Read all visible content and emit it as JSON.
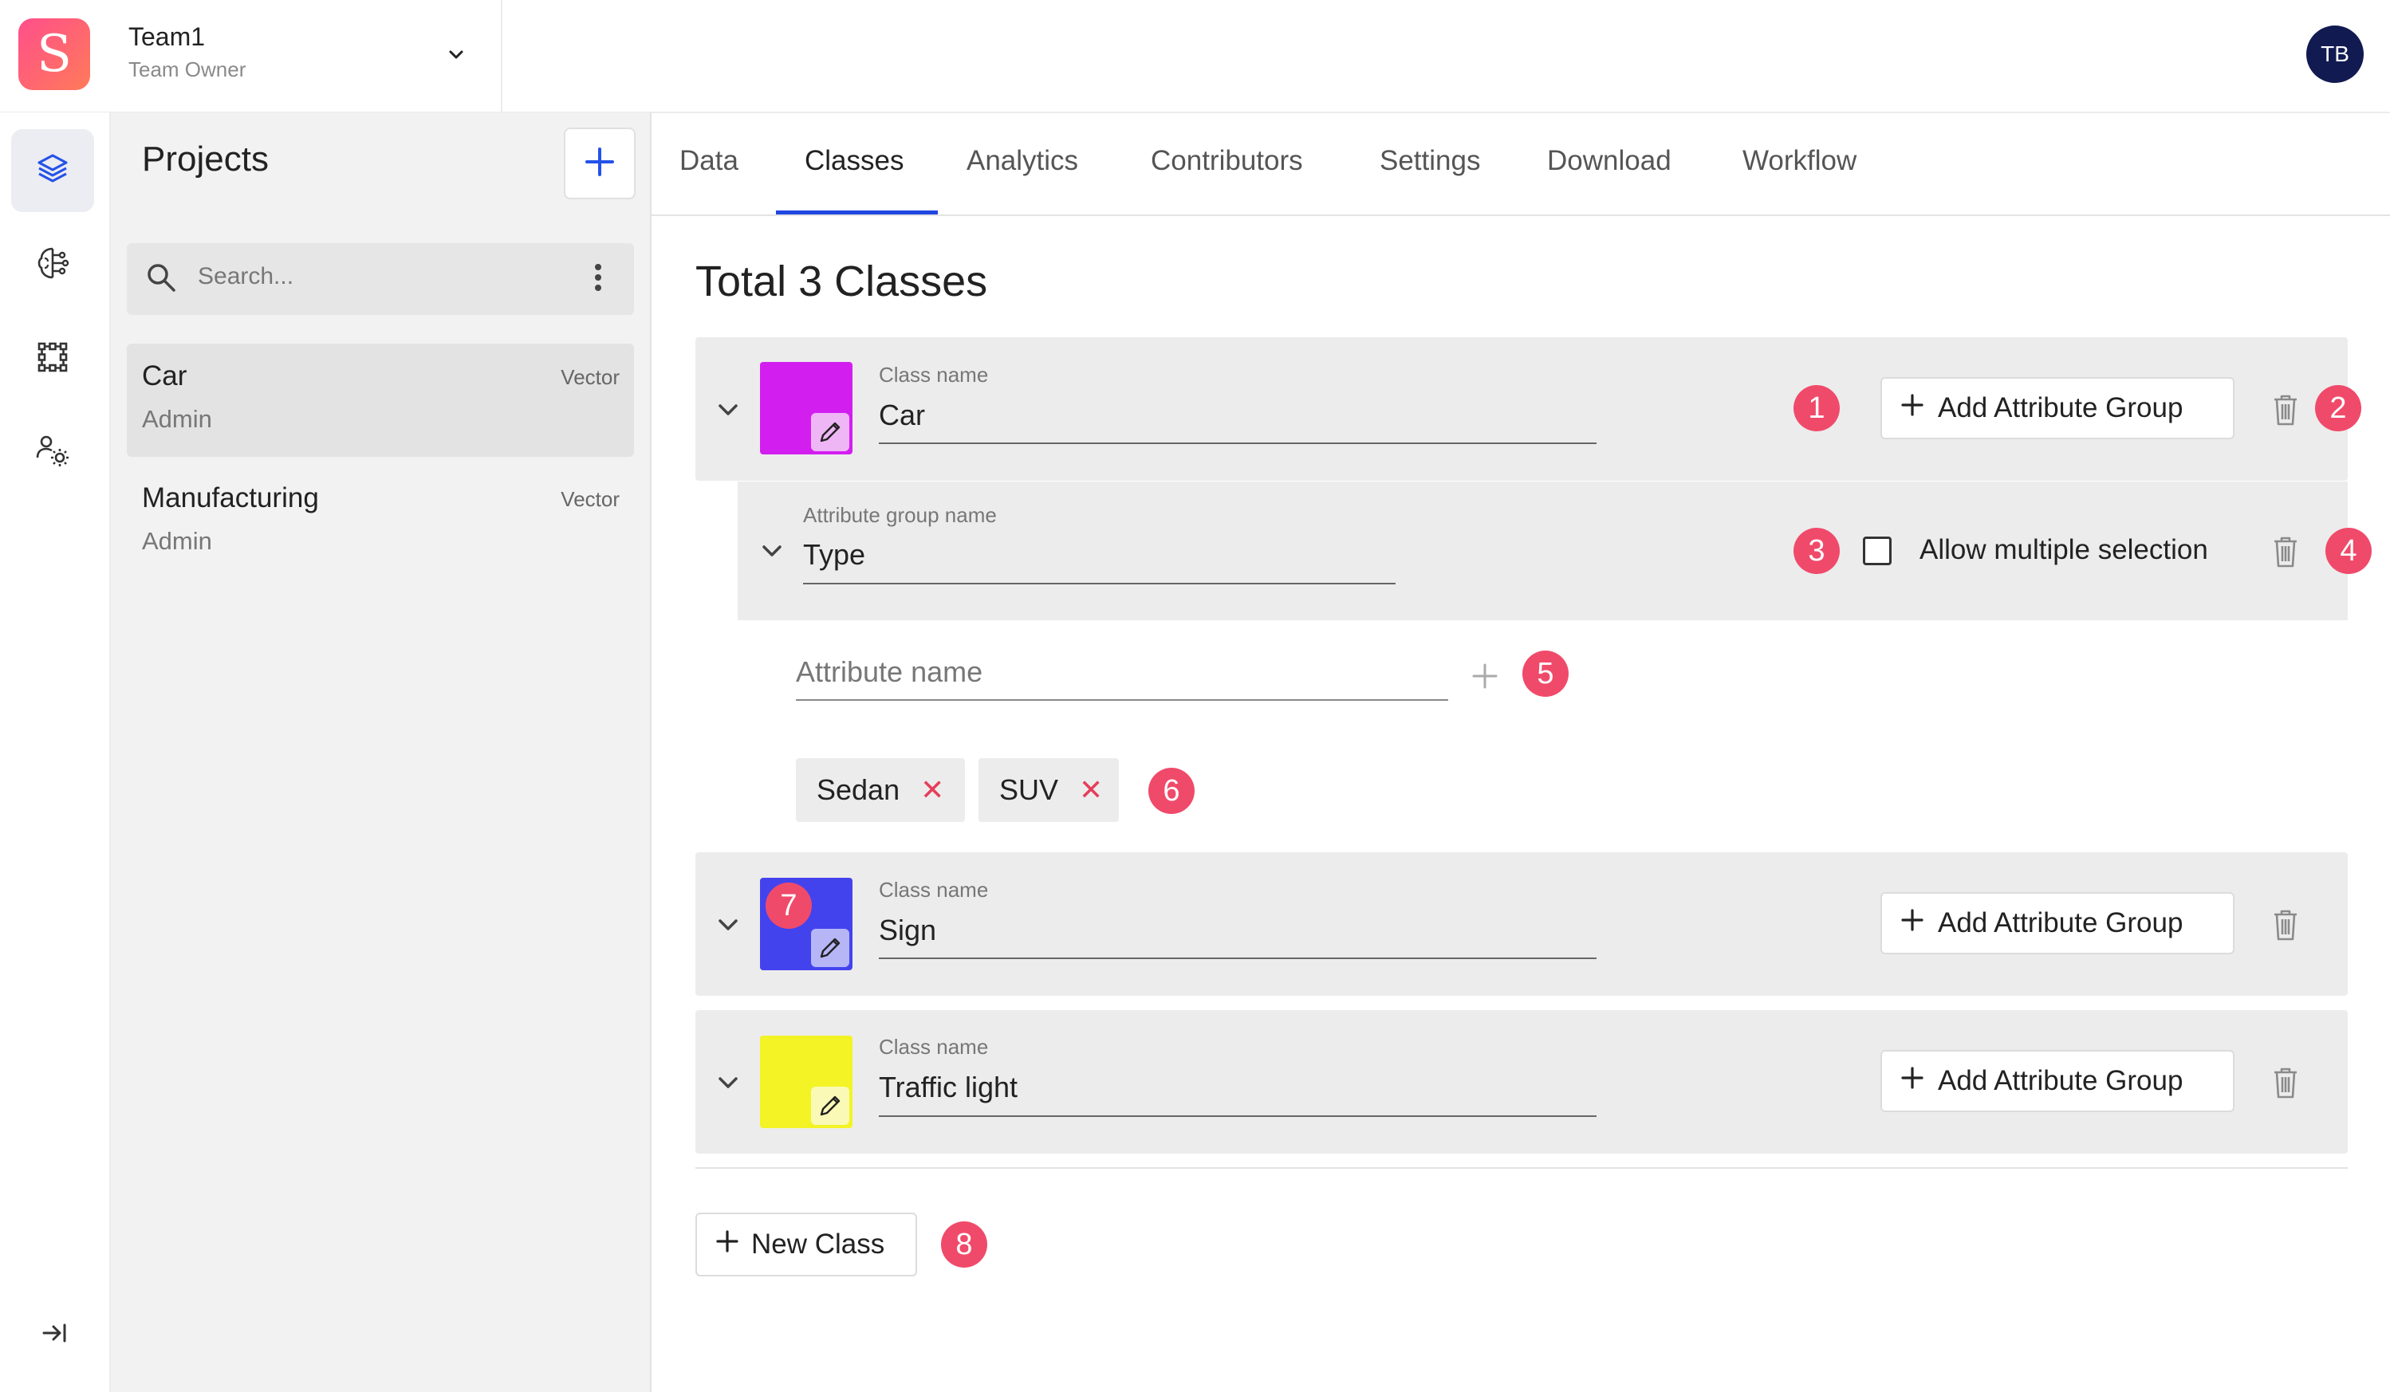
{
  "header": {
    "team_name": "Team1",
    "team_role": "Team Owner",
    "avatar_initials": "TB",
    "logo_letter": "S"
  },
  "rail": {
    "icons": [
      "layers-icon",
      "brain-icon",
      "grid-nodes-icon",
      "users-settings-icon"
    ],
    "collapse_icon": "collapse-right-icon"
  },
  "projects": {
    "title": "Projects",
    "search_placeholder": "Search...",
    "items": [
      {
        "name": "Car",
        "role": "Admin",
        "type": "Vector"
      },
      {
        "name": "Manufacturing",
        "role": "Admin",
        "type": "Vector"
      }
    ]
  },
  "tabs": [
    "Data",
    "Classes",
    "Analytics",
    "Contributors",
    "Settings",
    "Download",
    "Workflow"
  ],
  "active_tab": "Classes",
  "main": {
    "total_label": "Total 3 Classes",
    "class_label": "Class name",
    "add_attr_label": "Add Attribute Group",
    "attr_group_label": "Attribute group name",
    "attr_group_value": "Type",
    "allow_multiple_label": "Allow multiple selection",
    "attr_name_placeholder": "Attribute name",
    "attributes": [
      "Sedan",
      "SUV"
    ],
    "new_class_label": "New Class",
    "classes": [
      {
        "name": "Car",
        "color": "#d21ff0"
      },
      {
        "name": "Sign",
        "color": "#4343ee"
      },
      {
        "name": "Traffic light",
        "color": "#f3f325"
      }
    ],
    "badges": [
      "1",
      "2",
      "3",
      "4",
      "5",
      "6",
      "7",
      "8"
    ]
  }
}
